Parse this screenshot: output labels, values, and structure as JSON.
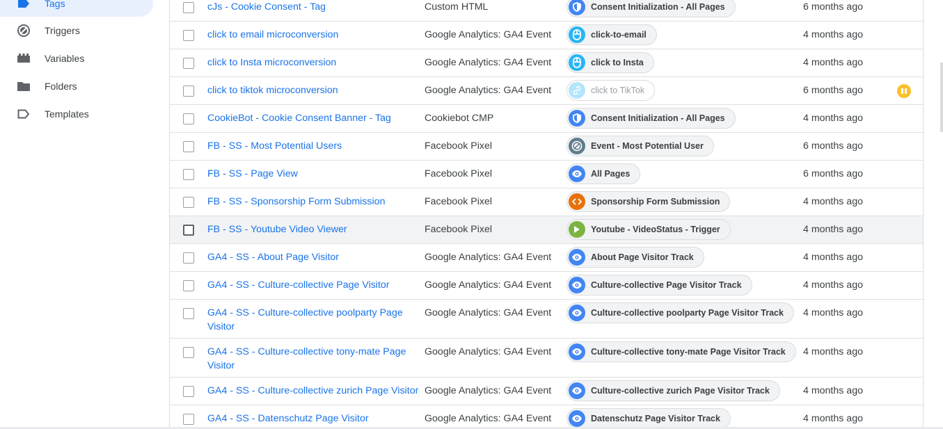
{
  "sidebar": {
    "items": [
      {
        "label": "Tags",
        "icon": "tag-icon",
        "active": true
      },
      {
        "label": "Triggers",
        "icon": "trigger-icon",
        "active": false
      },
      {
        "label": "Variables",
        "icon": "variables-icon",
        "active": false
      },
      {
        "label": "Folders",
        "icon": "folder-icon",
        "active": false
      },
      {
        "label": "Templates",
        "icon": "template-icon",
        "active": false
      }
    ]
  },
  "colors": {
    "link": "#1a73e8",
    "pause": "#fbc02d",
    "eye": "#4285f4",
    "shield": "#4285f4",
    "click": "#29b6f6",
    "link_faded": "#b3e5fc",
    "custom_event": "#607d8b",
    "form": "#e8710a",
    "youtube": "#7cb342"
  },
  "tags": [
    {
      "name": "cJs - Cookie Consent - Tag",
      "type": "Custom HTML",
      "trigger": "Consent Initialization - All Pages",
      "trigger_icon": "shield-icon",
      "modified": "6 months ago"
    },
    {
      "name": "click to email microconversion",
      "type": "Google Analytics: GA4 Event",
      "trigger": "click-to-email",
      "trigger_icon": "click-icon",
      "modified": "4 months ago"
    },
    {
      "name": "click to Insta microconversion",
      "type": "Google Analytics: GA4 Event",
      "trigger": "click to Insta",
      "trigger_icon": "click-icon",
      "modified": "4 months ago"
    },
    {
      "name": "click to tiktok microconversion",
      "type": "Google Analytics: GA4 Event",
      "trigger": "click to TikTok",
      "trigger_icon": "link-icon",
      "modified": "6 months ago",
      "paused": true
    },
    {
      "name": "CookieBot - Cookie Consent Banner - Tag",
      "type": "Cookiebot CMP",
      "trigger": "Consent Initialization - All Pages",
      "trigger_icon": "shield-icon",
      "modified": "4 months ago"
    },
    {
      "name": "FB - SS - Most Potential Users",
      "type": "Facebook Pixel",
      "trigger": "Event - Most Potential User",
      "trigger_icon": "custom-event-icon",
      "modified": "6 months ago"
    },
    {
      "name": "FB - SS - Page View",
      "type": "Facebook Pixel",
      "trigger": "All Pages",
      "trigger_icon": "eye-icon",
      "modified": "6 months ago"
    },
    {
      "name": "FB - SS - Sponsorship Form Submission",
      "type": "Facebook Pixel",
      "trigger": "Sponsorship Form Submission",
      "trigger_icon": "form-icon",
      "modified": "4 months ago"
    },
    {
      "name": "FB - SS - Youtube Video Viewer",
      "type": "Facebook Pixel",
      "trigger": "Youtube - VideoStatus - Trigger",
      "trigger_icon": "youtube-icon",
      "modified": "4 months ago",
      "hover": true
    },
    {
      "name": "GA4 - SS - About Page Visitor",
      "type": "Google Analytics: GA4 Event",
      "trigger": "About Page Visitor Track",
      "trigger_icon": "eye-icon",
      "modified": "4 months ago"
    },
    {
      "name": "GA4 - SS - Culture-collective Page Visitor",
      "type": "Google Analytics: GA4 Event",
      "trigger": "Culture-collective Page Visitor Track",
      "trigger_icon": "eye-icon",
      "modified": "4 months ago"
    },
    {
      "name": "GA4 - SS - Culture-collective poolparty Page Visitor",
      "type": "Google Analytics: GA4 Event",
      "trigger": "Culture-collective poolparty Page Visitor Track",
      "trigger_icon": "eye-icon",
      "modified": "4 months ago",
      "tall": true
    },
    {
      "name": "GA4 - SS - Culture-collective tony-mate Page Visitor",
      "type": "Google Analytics: GA4 Event",
      "trigger": "Culture-collective tony-mate Page Visitor Track",
      "trigger_icon": "eye-icon",
      "modified": "4 months ago",
      "tall": true
    },
    {
      "name": "GA4 - SS - Culture-collective zurich Page Visitor",
      "type": "Google Analytics: GA4 Event",
      "trigger": "Culture-collective zurich Page Visitor Track",
      "trigger_icon": "eye-icon",
      "modified": "4 months ago"
    },
    {
      "name": "GA4 - SS - Datenschutz Page Visitor",
      "type": "Google Analytics: GA4 Event",
      "trigger": "Datenschutz Page Visitor Track",
      "trigger_icon": "eye-icon",
      "modified": "4 months ago"
    }
  ]
}
